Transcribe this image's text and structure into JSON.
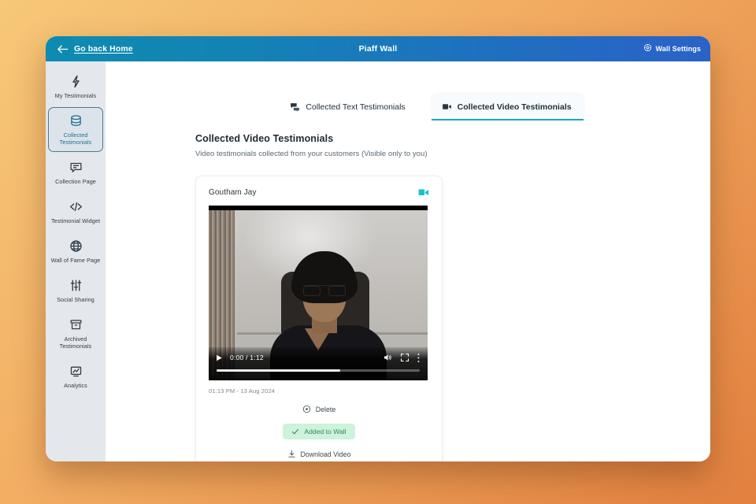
{
  "window": {
    "back_label": "Go back Home",
    "title": "Piaff Wall",
    "settings_label": "Wall Settings",
    "back_icon": "arrow-left-icon",
    "settings_icon": "gear-icon"
  },
  "sidebar": {
    "items": [
      {
        "label": "My Testimonials",
        "icon": "lightning-icon",
        "active": false
      },
      {
        "label": "Collected Testimonials",
        "icon": "database-icon",
        "active": true
      },
      {
        "label": "Collection Page",
        "icon": "message-icon",
        "active": false
      },
      {
        "label": "Testimonial Widget",
        "icon": "code-icon",
        "active": false
      },
      {
        "label": "Wall of Fame Page",
        "icon": "globe-icon",
        "active": false
      },
      {
        "label": "Social Sharing",
        "icon": "sliders-icon",
        "active": false
      },
      {
        "label": "Archived Testimonials",
        "icon": "archive-icon",
        "active": false
      },
      {
        "label": "Analytics",
        "icon": "chart-icon",
        "active": false
      }
    ]
  },
  "tabs": [
    {
      "label": "Collected Text Testimonials",
      "icon": "chat-bubbles-icon",
      "active": false
    },
    {
      "label": "Collected Video Testimonials",
      "icon": "video-camera-icon",
      "active": true
    }
  ],
  "main": {
    "title": "Collected Video Testimonials",
    "subtitle": "Video testimonials collected from your customers (Visible only to you)"
  },
  "card": {
    "author": "Goutham Jay",
    "type_icon": "video-camera-icon",
    "video": {
      "current_time": "0:00",
      "duration": "1:12",
      "time_display": "0:00 / 1:12",
      "play_icon": "play-icon",
      "volume_icon": "volume-icon",
      "fullscreen_icon": "fullscreen-icon",
      "menu_icon": "kebab-menu-icon",
      "progress_percent": 0,
      "buffered_percent": 61
    },
    "timestamp": "01:13 PM - 13 Aug 2024",
    "delete_label": "Delete",
    "delete_icon": "remove-circle-icon",
    "added_label": "Added to Wall",
    "added_icon": "check-icon",
    "download_label": "Download Video",
    "download_icon": "download-icon"
  },
  "colors": {
    "header_start": "#0e8bb0",
    "header_end": "#2b62c8",
    "accent_teal": "#19c4c4",
    "active_tab_underline": "#25a3ba",
    "pill_bg": "#cdf3dc",
    "pill_text": "#2f8b55",
    "sidebar_bg": "#e4e7ec",
    "page_bg_start": "#f6c878",
    "page_bg_end": "#e2803f"
  }
}
